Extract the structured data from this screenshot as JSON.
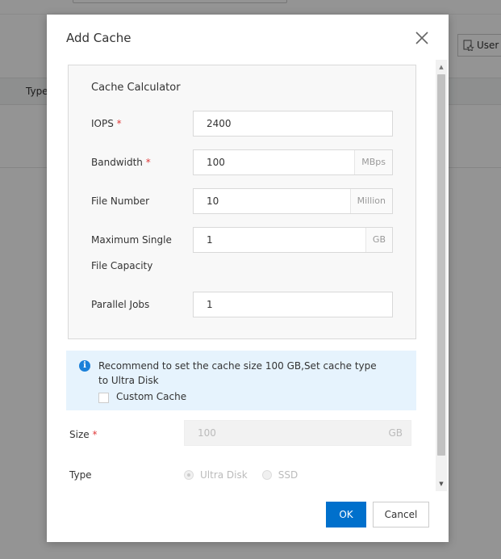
{
  "background": {
    "user_button_label": "User",
    "table_column_type": "Type"
  },
  "modal": {
    "title": "Add Cache",
    "calculator": {
      "title": "Cache Calculator",
      "fields": [
        {
          "label": "IOPS",
          "required": "*",
          "value": "2400",
          "unit": ""
        },
        {
          "label": "Bandwidth",
          "required": "*",
          "value": "100",
          "unit": "MBps"
        },
        {
          "label": "File Number",
          "required": "",
          "value": "10",
          "unit": "Million"
        },
        {
          "label": "Maximum Single",
          "label2": "File Capacity",
          "required": "",
          "value": "1",
          "unit": "GB"
        },
        {
          "label": "Parallel Jobs",
          "required": "",
          "value": "1",
          "unit": ""
        }
      ]
    },
    "recommendation": {
      "text": "Recommend to set the cache size 100 GB,Set cache type to Ultra Disk",
      "custom_cache_label": "Custom Cache"
    },
    "size": {
      "label": "Size",
      "required": "*",
      "value": "100",
      "unit": "GB"
    },
    "type": {
      "label": "Type",
      "options": [
        "Ultra Disk",
        "SSD"
      ],
      "selected": "Ultra Disk"
    },
    "buttons": {
      "ok": "OK",
      "cancel": "Cancel"
    }
  },
  "colors": {
    "primary": "#0070cc",
    "info": "#1a80d9",
    "required": "#e03a3a",
    "recommend_bg": "#e6f3fd"
  }
}
